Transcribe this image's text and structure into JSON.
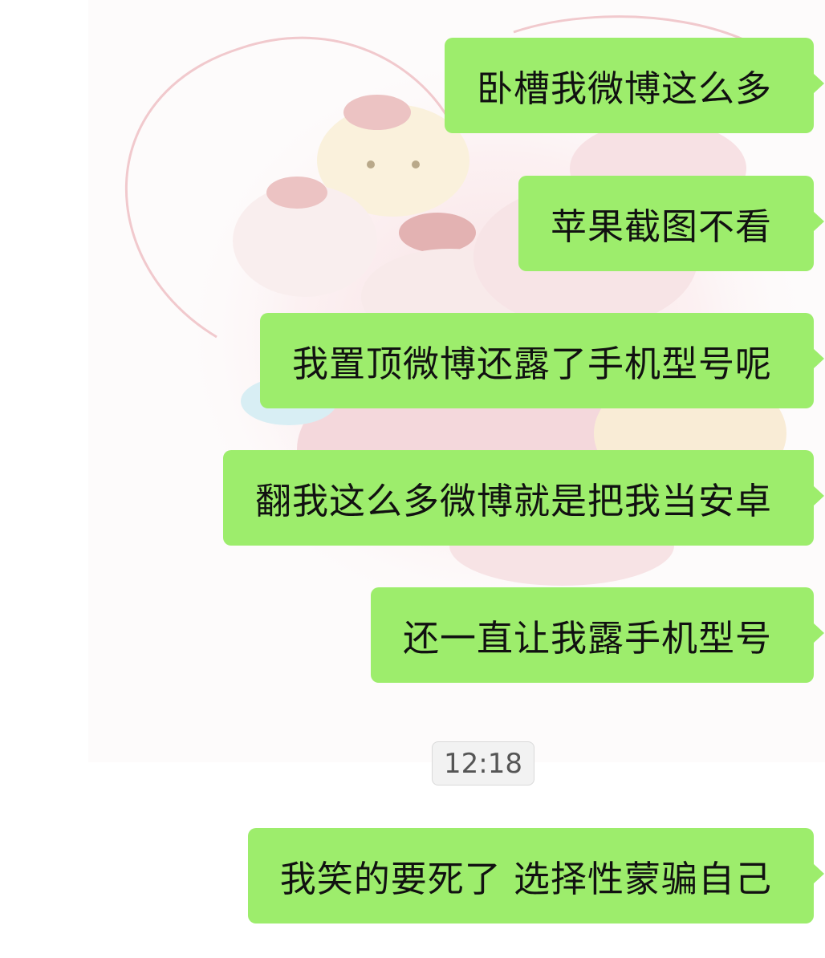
{
  "colors": {
    "bubble": "#9ded6c",
    "text": "#111111",
    "time_badge_bg": "#f2f2f2",
    "time_badge_text": "#555555"
  },
  "messages_before": [
    {
      "text": "卧槽我微博这么多"
    },
    {
      "text": "苹果截图不看"
    },
    {
      "text": "我置顶微博还露了手机型号呢"
    },
    {
      "text": "翻我这么多微博就是把我当安卓"
    },
    {
      "text": "还一直让我露手机型号"
    }
  ],
  "timestamp": "12:18",
  "messages_after": [
    {
      "text": "我笑的要死了 选择性蒙骗自己"
    }
  ]
}
